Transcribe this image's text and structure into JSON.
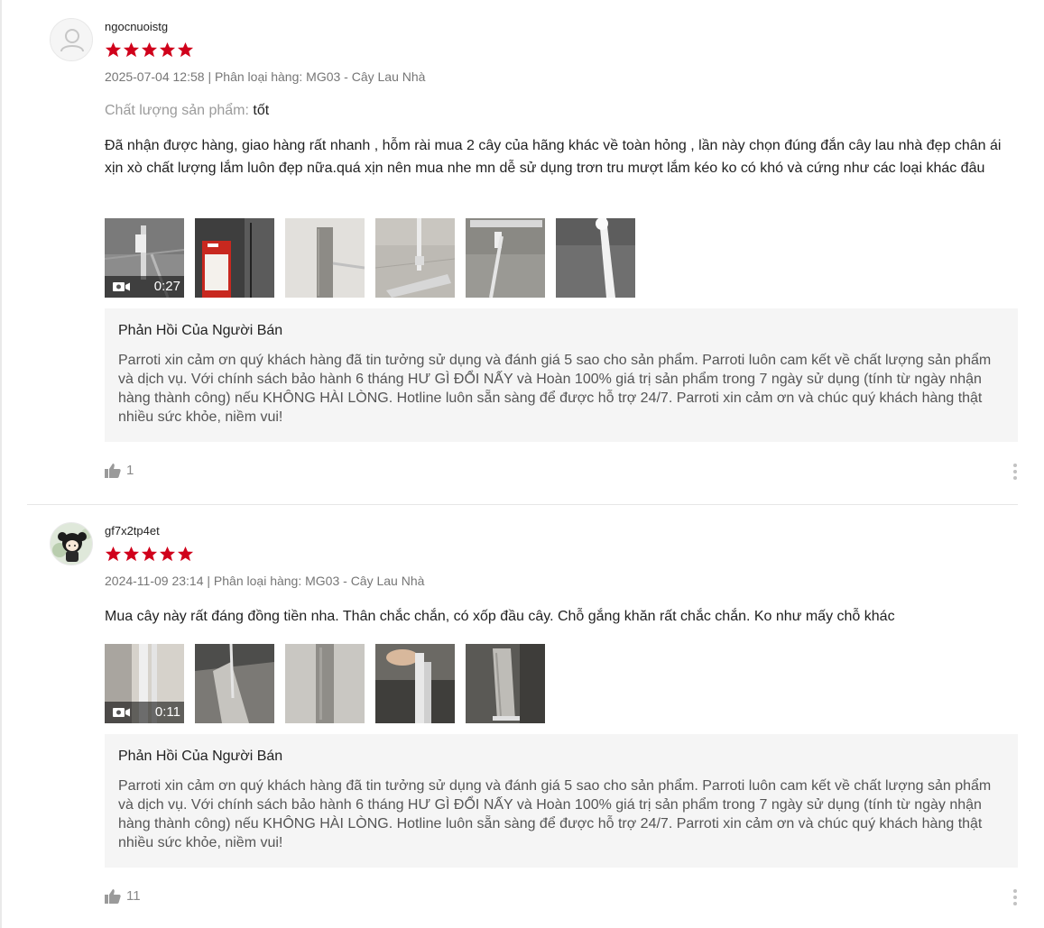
{
  "reviews": [
    {
      "username": "ngocnuoistg",
      "rating": 5,
      "date": "2025-07-04 12:58",
      "variant_label": "Phân loại hàng:",
      "variant_value": "MG03 - Cây Lau Nhà",
      "quality_label": "Chất lượng sản phẩm:",
      "quality_value": "tốt",
      "comment": "Đã nhận được hàng, giao hàng rất nhanh  , hỗm rài mua 2 cây của hãng khác về toàn hỏng , lần này chọn đúng đắn cây lau nhà đẹp chân ái xịn xò chất lượng lắm luôn đẹp nữa.quá xịn nên mua nhe mn dễ sử dụng trơn tru mượt lắm kéo ko có khó và cứng như các loại khác đâu",
      "video_duration": "0:27",
      "media_count": 6,
      "reply_title": "Phản Hồi Của Người Bán",
      "reply_text": "Parroti xin cảm ơn quý khách hàng đã tin tưởng sử dụng và đánh giá 5 sao cho sản phẩm. Parroti luôn cam kết về chất lượng sản phẩm và dịch vụ. Với chính sách bảo hành 6 tháng HƯ GÌ ĐỔI NẤY và Hoàn 100% giá trị sản phẩm trong 7 ngày sử dụng (tính từ ngày nhận hàng thành công) nếu KHÔNG HÀI LÒNG. Hotline luôn sẵn sàng để được hỗ trợ 24/7. Parroti xin cảm ơn và chúc quý khách hàng thật nhiều sức khỏe, niềm vui!",
      "likes": "1"
    },
    {
      "username": "gf7x2tp4et",
      "rating": 5,
      "date": "2024-11-09 23:14",
      "variant_label": "Phân loại hàng:",
      "variant_value": "MG03 - Cây Lau Nhà",
      "comment": "Mua cây này rất đáng đồng tiền nha. Thân chắc chắn, có xốp đầu cây. Chỗ gắng khăn rất chắc chắn. Ko như mấy chỗ khác",
      "video_duration": "0:11",
      "media_count": 5,
      "reply_title": "Phản Hồi Của Người Bán",
      "reply_text": "Parroti xin cảm ơn quý khách hàng đã tin tưởng sử dụng và đánh giá 5 sao cho sản phẩm. Parroti luôn cam kết về chất lượng sản phẩm và dịch vụ. Với chính sách bảo hành 6 tháng HƯ GÌ ĐỔI NẤY và Hoàn 100% giá trị sản phẩm trong 7 ngày sử dụng (tính từ ngày nhận hàng thành công) nếu KHÔNG HÀI LÒNG. Hotline luôn sẵn sàng để được hỗ trợ 24/7. Parroti xin cảm ơn và chúc quý khách hàng thật nhiều sức khỏe, niềm vui!",
      "likes": "11"
    }
  ],
  "colors": {
    "star": "#d0011b",
    "muted_text": "#767676",
    "reply_bg": "#f5f5f5"
  },
  "icons": {
    "avatar_default": "user-silhouette-icon",
    "star": "star-icon",
    "video": "video-camera-icon",
    "like": "thumbs-up-icon",
    "more": "vertical-ellipsis-icon"
  }
}
